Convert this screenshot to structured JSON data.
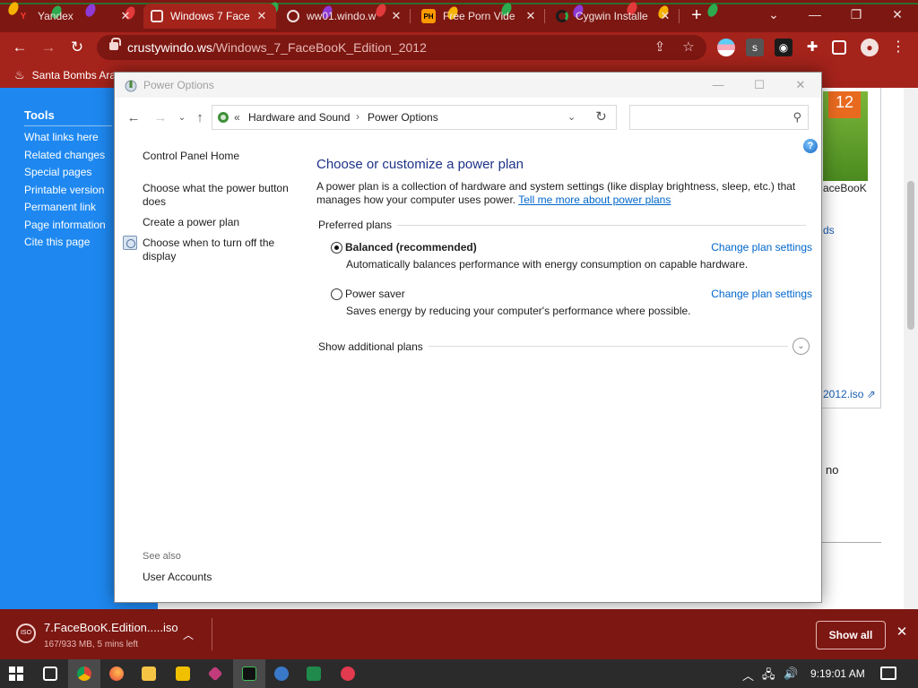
{
  "browser": {
    "tabs": [
      {
        "label": "Yandex",
        "icon_letter": "Y",
        "active": false
      },
      {
        "label": "Windows 7 Face",
        "icon_letter": "",
        "active": true
      },
      {
        "label": "ww01.windo.w",
        "icon_letter": "",
        "active": false
      },
      {
        "label": "Free Porn Vide",
        "icon_letter": "PH",
        "active": false
      },
      {
        "label": "Cygwin Installe",
        "icon_letter": "",
        "active": false
      }
    ],
    "url_host": "crustywindo.ws",
    "url_path": "/Windows_7_FaceBooK_Edition_2012",
    "bookmark_label": "Santa Bombs Ara",
    "ext_letter": "s",
    "accent_color": "#a4231b",
    "dark_accent_color": "#7d1712"
  },
  "background_page": {
    "tools_heading": "Tools",
    "tools_links": [
      "What links here",
      "Related changes",
      "Special pages",
      "Printable version",
      "Permanent link",
      "Page information",
      "Cite this page"
    ],
    "image_number": "12",
    "image_caption": "aceBooK",
    "link_fragment_1": "ds",
    "link_fragment_2": "2012.iso",
    "text_fragment": "no",
    "sidebar_color": "#1e88f0"
  },
  "window": {
    "title": "Power Options",
    "breadcrumb": [
      "Hardware and Sound",
      "Power Options"
    ],
    "breadcrumb_prefix": "«",
    "search_placeholder": "",
    "left_nav": {
      "home": "Control Panel Home",
      "links": [
        "Choose what the power button does",
        "Create a power plan",
        "Choose when to turn off the display"
      ],
      "see_also_label": "See also",
      "see_also_links": [
        "User Accounts"
      ]
    },
    "main": {
      "heading": "Choose or customize a power plan",
      "description": "A power plan is a collection of hardware and system settings (like display brightness, sleep, etc.) that manages how your computer uses power.",
      "description_link": "Tell me more about power plans",
      "preferred_plans_label": "Preferred plans",
      "plans": [
        {
          "name": "Balanced (recommended)",
          "selected": true,
          "description": "Automatically balances performance with energy consumption on capable hardware.",
          "link": "Change plan settings"
        },
        {
          "name": "Power saver",
          "selected": false,
          "description": "Saves energy by reducing your computer's performance where possible.",
          "link": "Change plan settings"
        }
      ],
      "additional_plans_label": "Show additional plans"
    }
  },
  "download_bar": {
    "file_name": "7.FaceBooK.Edition.....iso",
    "progress_text": "167/933 MB, 5 mins left",
    "show_all_label": "Show all",
    "file_icon_text": "ISO"
  },
  "taskbar": {
    "clock": "9:19:01 AM"
  }
}
